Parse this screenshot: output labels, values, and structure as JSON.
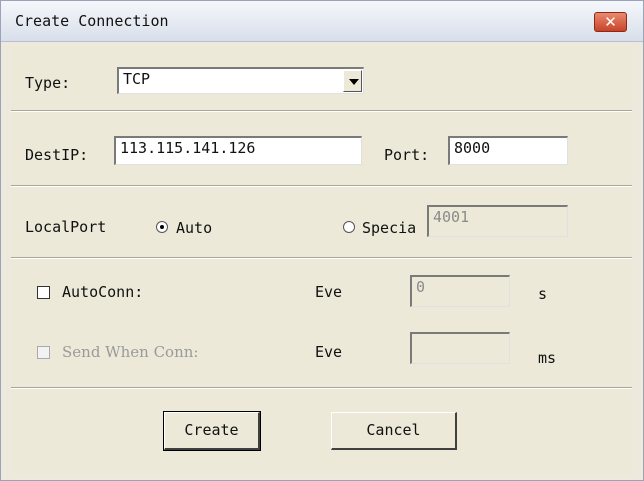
{
  "window": {
    "title": "Create Connection"
  },
  "type_row": {
    "label": "Type:",
    "value": "TCP"
  },
  "dest_row": {
    "destip_label": "DestIP:",
    "destip_value": "113.115.141.126",
    "port_label": "Port:",
    "port_value": "8000"
  },
  "localport_row": {
    "label": "LocalPort",
    "auto_label": "Auto",
    "special_label": "Specia",
    "special_value": "4001",
    "selected": "Auto"
  },
  "autoconn_row": {
    "label": "AutoConn:",
    "checked": false,
    "every_label": "Eve",
    "every_value": "0",
    "unit": "s"
  },
  "sendwhen_row": {
    "label": "Send When Conn:",
    "checked": false,
    "enabled": false,
    "every_label": "Eve",
    "every_value": "",
    "unit": "ms"
  },
  "buttons": {
    "create": "Create",
    "cancel": "Cancel"
  },
  "colors": {
    "titlebar_close": "#c7432a",
    "dialog_bg": "#ece9d8"
  }
}
